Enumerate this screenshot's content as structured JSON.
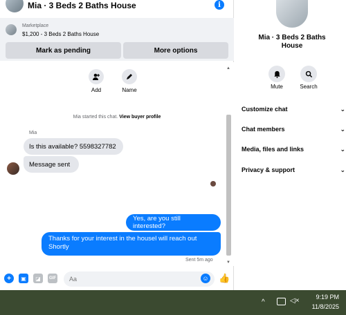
{
  "header": {
    "title": "Mia · 3 Beds 2 Baths House"
  },
  "listing": {
    "label": "Marketplace",
    "price_line": "$1,200 - 3 Beds 2 Baths House"
  },
  "actions": {
    "mark_pending": "Mark as pending",
    "more_options": "More options"
  },
  "quick_actions": [
    {
      "label": "Add",
      "icon": "add-user-icon"
    },
    {
      "label": "Name",
      "icon": "pencil-icon"
    }
  ],
  "system": {
    "started": "Mia started this chat.",
    "view_profile": "View buyer profile"
  },
  "incoming": {
    "sender": "Mia",
    "messages": [
      "Is this available? 5598327782",
      "Message sent"
    ]
  },
  "outgoing": {
    "messages": [
      "Yes, are you still interested?",
      "Thanks for your interest in the housel will reach out Shortly"
    ],
    "status": "Sent 5m ago"
  },
  "composer": {
    "placeholder": "Aa"
  },
  "info_pane": {
    "title": "Mia · 3 Beds 2 Baths House",
    "buttons": [
      {
        "label": "Mute",
        "icon": "bell-icon"
      },
      {
        "label": "Search",
        "icon": "search-icon"
      }
    ],
    "sections": [
      "Customize chat",
      "Chat members",
      "Media, files and links",
      "Privacy & support"
    ]
  },
  "taskbar": {
    "time": "9:19 PM",
    "date": "11/8/2025"
  },
  "colors": {
    "accent": "#0a7cff",
    "bubble_in": "#e4e6eb",
    "panel_gray": "#f0f2f5",
    "taskbar": "#3b4a30"
  }
}
